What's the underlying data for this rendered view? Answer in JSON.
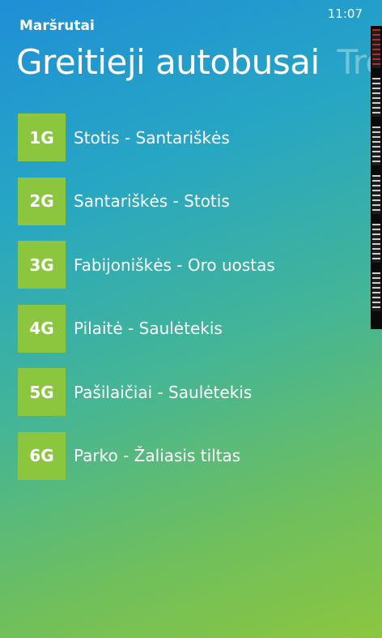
{
  "status_bar": {
    "time": "11:07"
  },
  "app": {
    "title": "Maršrutai"
  },
  "pivot": {
    "active": "Greitieji autobusai",
    "next": "Tro"
  },
  "routes": [
    {
      "code": "1G",
      "name": "Stotis - Santariškės"
    },
    {
      "code": "2G",
      "name": "Santariškės - Stotis"
    },
    {
      "code": "3G",
      "name": "Fabijoniškės - Oro uostas"
    },
    {
      "code": "4G",
      "name": "Pilaitė - Saulėtekis"
    },
    {
      "code": "5G",
      "name": "Pašilaičiai - Saulėtekis"
    },
    {
      "code": "6G",
      "name": "Parko - Žaliasis tiltas"
    }
  ],
  "colors": {
    "badge": "#8cc63f",
    "gradient_top": "#1f8fd6",
    "gradient_bottom": "#8cc63f"
  }
}
